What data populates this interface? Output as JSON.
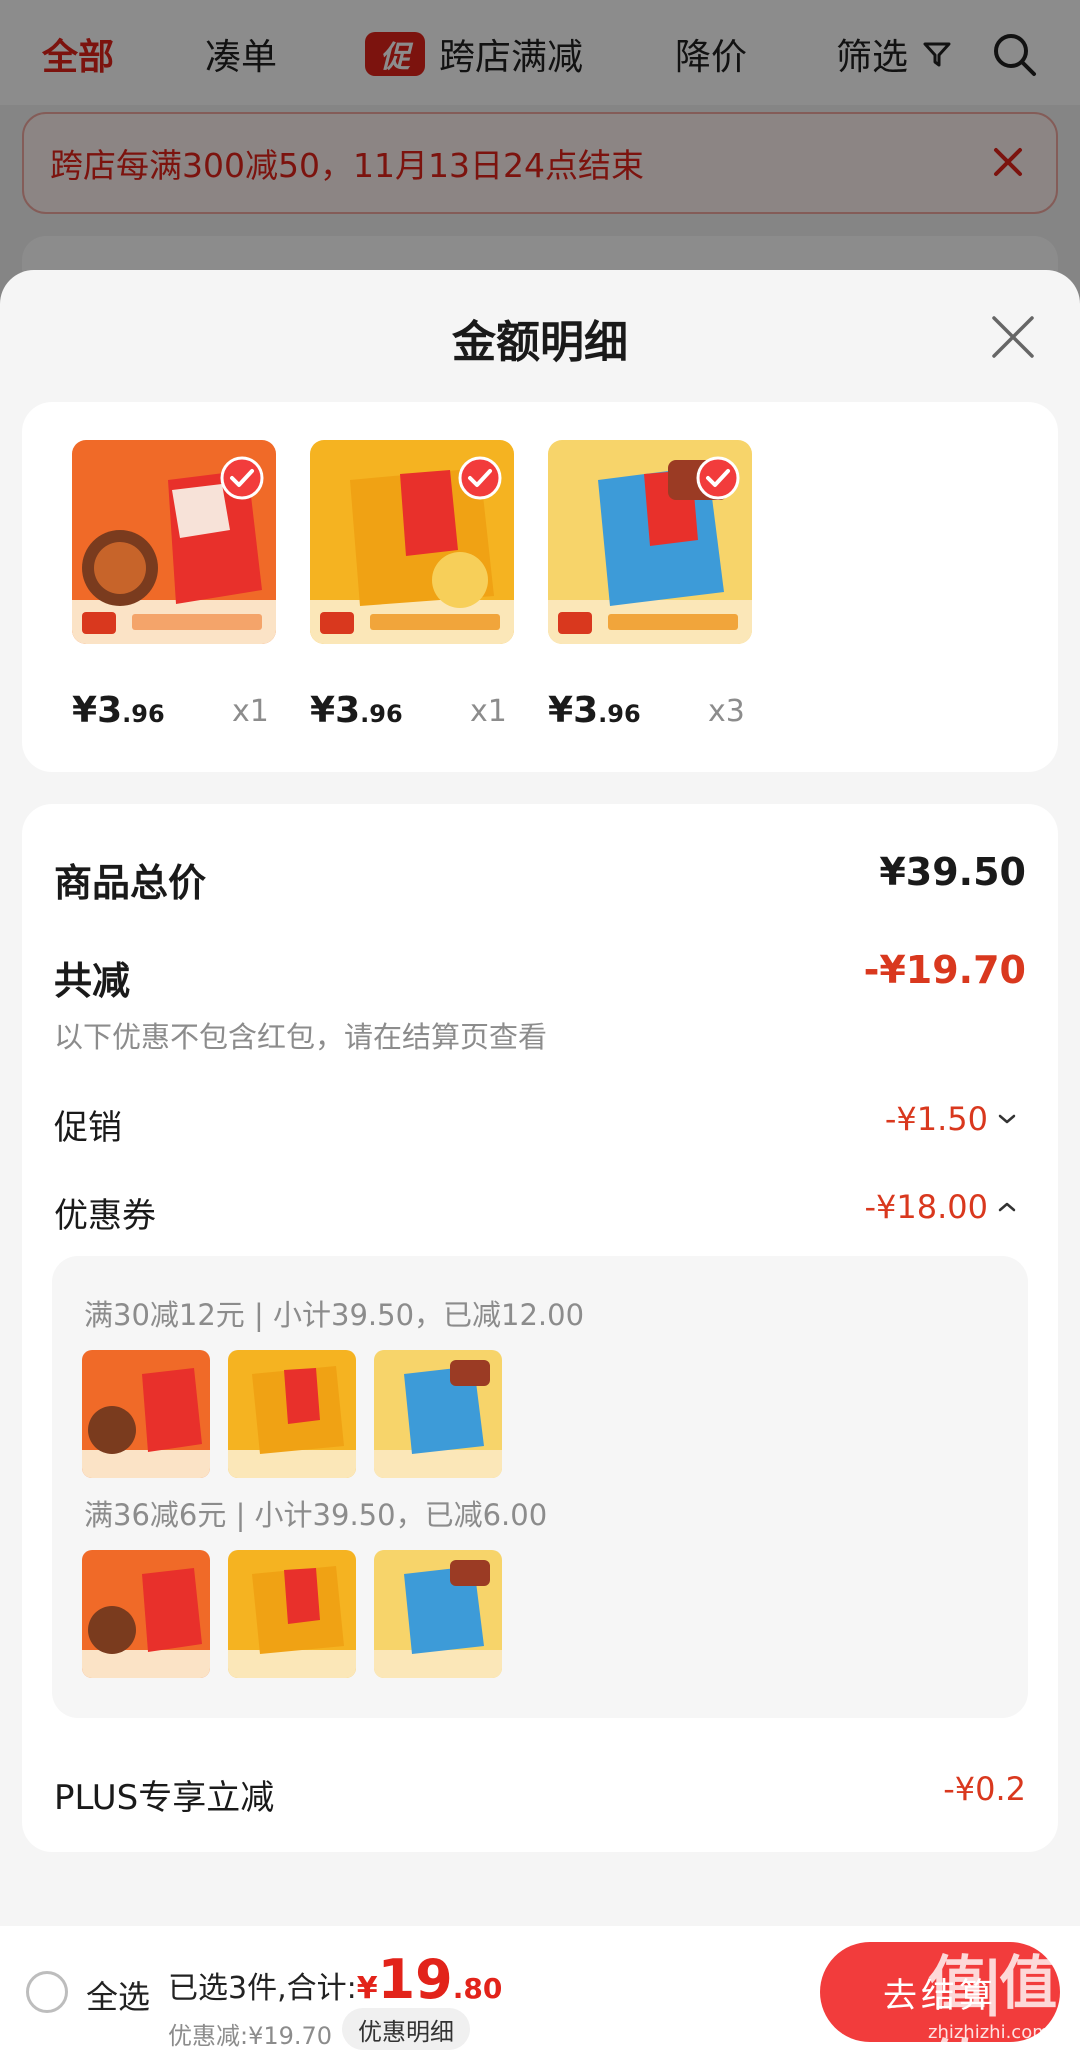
{
  "nav": {
    "all": "全部",
    "combine": "凑单",
    "promo_badge": "促",
    "cross_store": "跨店满减",
    "price_drop": "降价",
    "filter": "筛选"
  },
  "notice": {
    "text": "跨店每满300减50，11月13日24点结束"
  },
  "sheet": {
    "title": "金额明细"
  },
  "products": [
    {
      "price_symbol": "¥",
      "price_int": "3",
      "price_dec": ".96",
      "qty": "x1"
    },
    {
      "price_symbol": "¥",
      "price_int": "3",
      "price_dec": ".96",
      "qty": "x1"
    },
    {
      "price_symbol": "¥",
      "price_int": "3",
      "price_dec": ".96",
      "qty": "x3"
    }
  ],
  "detail": {
    "total_label": "商品总价",
    "total_value": "¥39.50",
    "reduce_label": "共减",
    "reduce_value": "-¥19.70",
    "note": "以下优惠不包含红包，请在结算页查看",
    "promo_label": "促销",
    "promo_value": "-¥1.50",
    "coupon_label": "优惠券",
    "coupon_value": "-¥18.00",
    "coupon_lines": [
      "满30减12元 | 小计39.50，已减12.00",
      "满36减6元 | 小计39.50，已减6.00"
    ],
    "plus_label": "PLUS专享立减",
    "plus_value": "-¥0.2"
  },
  "bottom": {
    "select_all": "全选",
    "selected_text": "已选3件,合计:",
    "total_currency": "¥",
    "total_int": "19",
    "total_dec": ".80",
    "discount_text": "优惠减:¥19.70",
    "detail_chip": "优惠明细",
    "checkout": "去结算"
  },
  "watermark": {
    "main": "值|值|值",
    "sub": "zhizhizhi.com"
  },
  "colors": {
    "accent": "#e2231a",
    "discount": "#d9381e",
    "checkout": "#f23c3c"
  },
  "icons": {
    "search": "search-icon",
    "filter": "filter-icon",
    "close": "close-icon",
    "check": "check-circle-icon"
  }
}
